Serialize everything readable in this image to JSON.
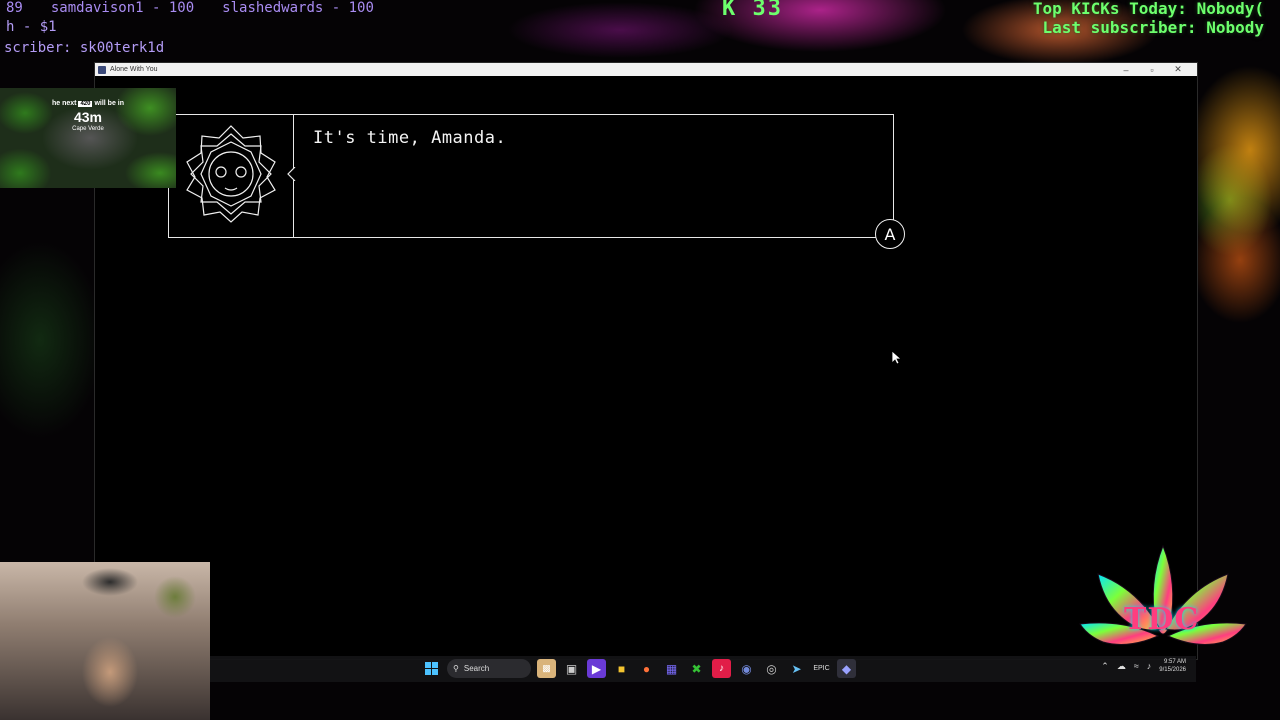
{
  "stream_overlay": {
    "ticker": [
      "89",
      "samdavison1 - 100",
      "slashedwards - 100"
    ],
    "donation": "h - $1",
    "subscriber_line": "scriber: sk00terk1d",
    "kick_counter": "K 33",
    "top_kicks": "Top KICKs Today: Nobody(",
    "last_subscriber": "Last subscriber: Nobody",
    "countdown": {
      "line_prefix": "he next",
      "line_highlight": "420",
      "line_suffix": "will be in",
      "time": "43m",
      "place": "Cape Verde"
    },
    "logo_text": "TDC"
  },
  "window": {
    "title": "Alone With You",
    "controls": {
      "minimize": "–",
      "maximize": "▫",
      "close": "✕"
    }
  },
  "game": {
    "dialog_text": "It's time, Amanda.",
    "advance_button": "A",
    "portrait_icon": "geometric-face-icon"
  },
  "taskbar": {
    "search_placeholder": "Search",
    "clock_time": "9:57 AM",
    "clock_date": "9/15/2026",
    "icons": [
      "windows-start-icon",
      "search-icon",
      "widgets-icon",
      "task-view-icon",
      "media-icon",
      "file-explorer-icon",
      "firefox-icon",
      "app-grid-icon",
      "xbox-icon",
      "tiktok-icon",
      "discord-icon",
      "obs-icon",
      "steam-icon",
      "epic-games-icon",
      "game-icon"
    ]
  }
}
